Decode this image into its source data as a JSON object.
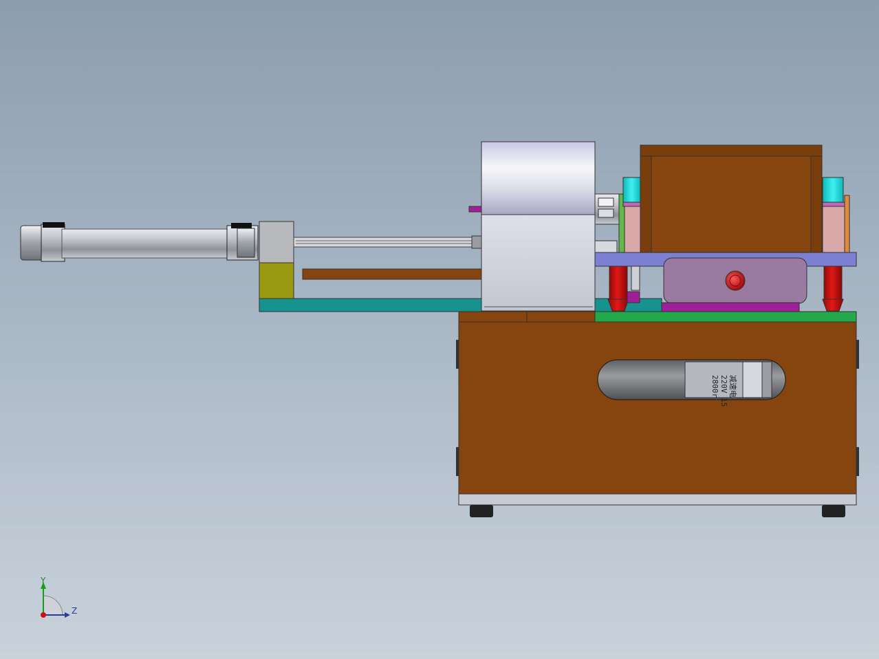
{
  "app": {
    "view": "Front",
    "background_top": "#8c9dae",
    "background_bottom": "#c9d2db"
  },
  "colors": {
    "wood": "#86450f",
    "wood_dark": "#6b360b",
    "teal_plate": "#17938f",
    "green_plate": "#23a84a",
    "blue_plate": "#7c7fd2",
    "cyan_part": "#22d6d6",
    "olive_block": "#9a9a10",
    "mauve_cover": "#9a7aa0",
    "magenta_part": "#a0209a",
    "red_leg": "#c81010",
    "red_button": "#d41010",
    "silver": "#c8cad0",
    "gray_foot": "#222222",
    "pink_plate": "#d9a8a8"
  },
  "parts": {
    "cylinder": "pneumatic-cylinder",
    "spindle_housing": "spindle-housing",
    "gearbox": "upper-wood-box",
    "base": "wood-base-cabinet",
    "motor_window": "motor-window"
  },
  "motor_label": {
    "line1": "减速电",
    "line2": "220V 15",
    "line3": "2800r"
  },
  "triad": {
    "y_label": "Y",
    "z_label": "Z"
  }
}
